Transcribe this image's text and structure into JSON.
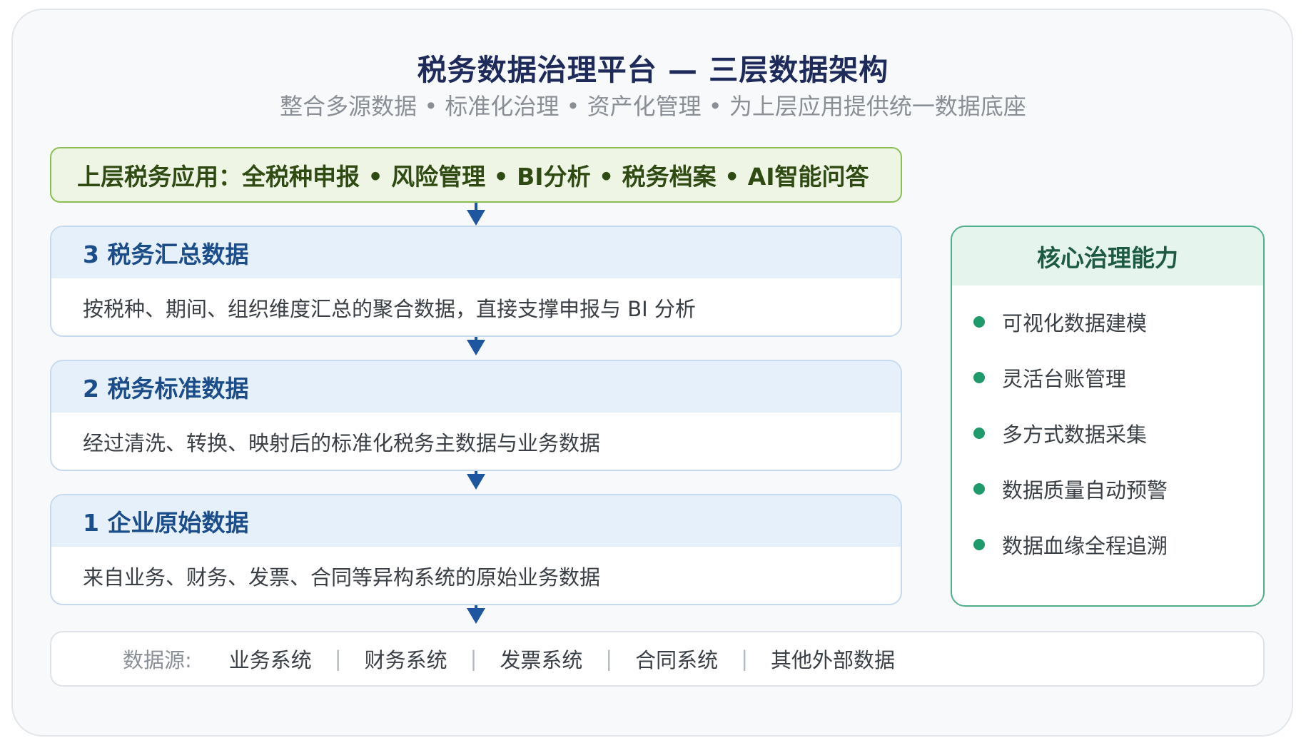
{
  "header": {
    "title": "税务数据治理平台 — 三层数据架构",
    "subtitle": "整合多源数据 • 标准化治理 • 资产化管理 • 为上层应用提供统一数据底座"
  },
  "apps_bar": {
    "text": "上层税务应用：全税种申报 • 风险管理 • BI分析 • 税务档案 • AI智能问答"
  },
  "layers": [
    {
      "title": "3 税务汇总数据",
      "desc": "按税种、期间、组织维度汇总的聚合数据，直接支撑申报与 BI 分析"
    },
    {
      "title": "2 税务标准数据",
      "desc": "经过清洗、转换、映射后的标准化税务主数据与业务数据"
    },
    {
      "title": "1 企业原始数据",
      "desc": "来自业务、财务、发票、合同等异构系统的原始业务数据"
    }
  ],
  "side_panel": {
    "title": "核心治理能力",
    "items": [
      "可视化数据建模",
      "灵活台账管理",
      "多方式数据采集",
      "数据质量自动预警",
      "数据血缘全程追溯"
    ]
  },
  "sources": {
    "label": "数据源:",
    "items": [
      "业务系统",
      "财务系统",
      "发票系统",
      "合同系统",
      "其他外部数据"
    ],
    "separator": "|"
  },
  "colors": {
    "apps_bar_border": "#8bbf55",
    "layer_header_bg": "#e6f0fb",
    "arrow": "#1f56a0",
    "side_panel_border": "#4fae8a",
    "bullet": "#1f9a6a"
  }
}
